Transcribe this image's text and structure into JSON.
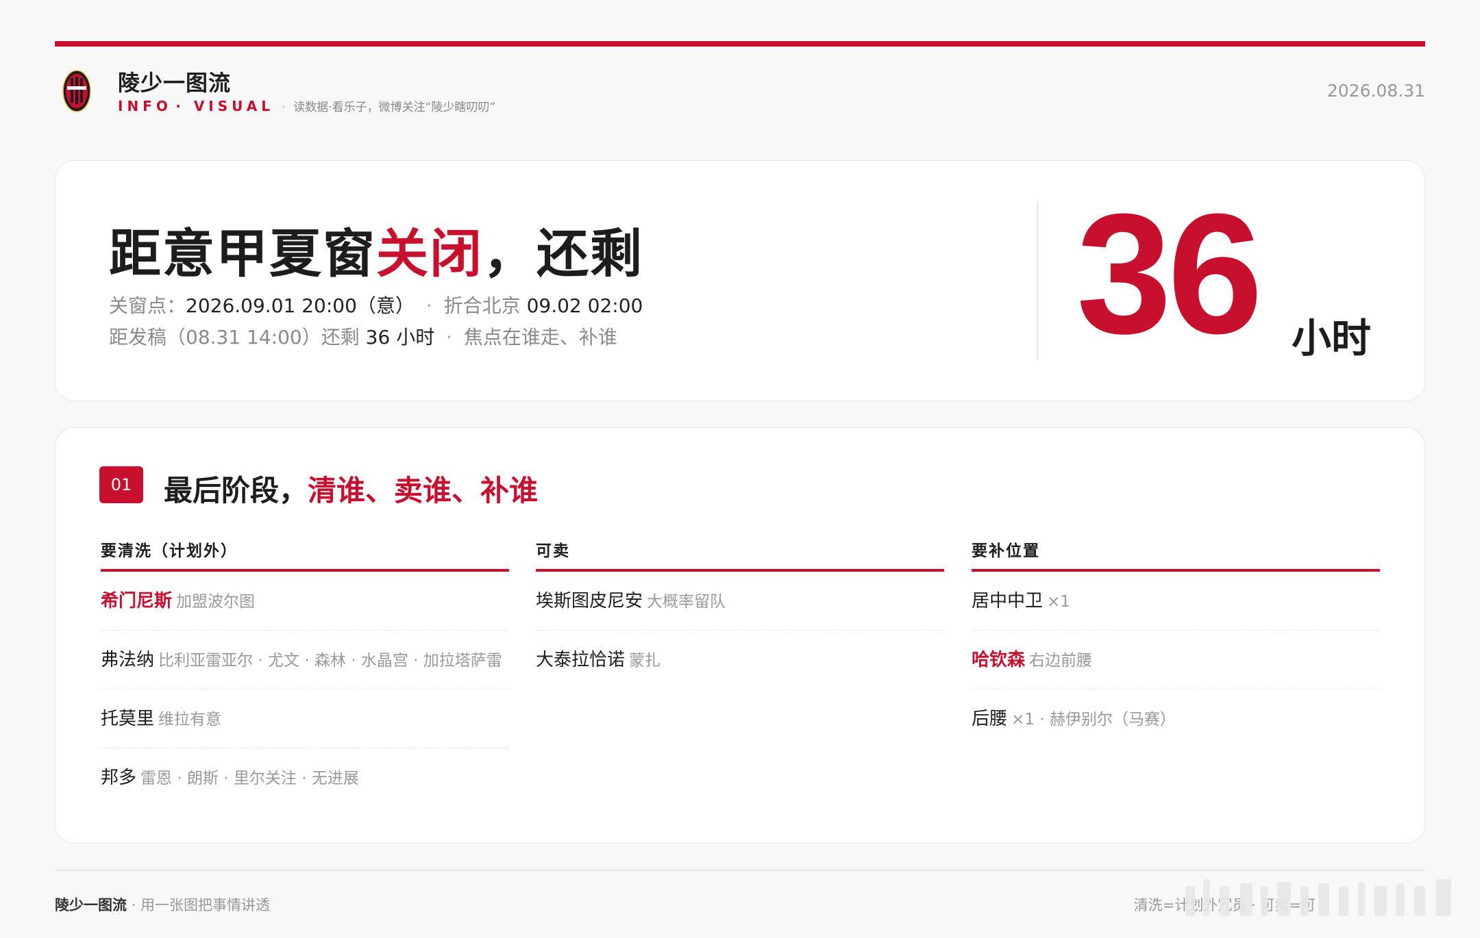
{
  "header": {
    "title": "陵少一图流",
    "sub_en_1": "INFO",
    "sub_en_2": "VISUAL",
    "sub_text": "读数据·看乐子，微博关注“陵少瞎叨叨”",
    "date": "2026.08.31"
  },
  "hero": {
    "title_pre": "距意甲夏窗",
    "title_red": "关闭",
    "title_post": "，还剩",
    "meta1_label": "关窗点：",
    "meta1_value": "2026.09.01 20:00（意）",
    "meta1_label2": "折合北京",
    "meta1_value2": "09.02 02:00",
    "meta2_pre": "距发稿（08.31 14:00）还剩",
    "meta2_value": "36 小时",
    "meta2_post": "焦点在谁走、补谁",
    "countdown": "36",
    "countdown_unit": "小时"
  },
  "section": {
    "badge": "01",
    "title_pre": "最后阶段，",
    "title_red": "清谁、卖谁、补谁",
    "columns": [
      {
        "header": "要清洗（计划外）",
        "rows": [
          {
            "name": "希门尼斯",
            "note": "加盟波尔图"
          },
          {
            "name": "弗法纳",
            "note": "比利亚雷亚尔 · 尤文 · 森林 · 水晶宫 · 加拉塔萨雷"
          },
          {
            "name": "托莫里",
            "note": "维拉有意"
          },
          {
            "name": "邦多",
            "note": "雷恩 · 朗斯 · 里尔关注 · 无进展"
          }
        ]
      },
      {
        "header": "可卖",
        "rows": [
          {
            "name": "埃斯图皮尼安",
            "note": "大概率留队"
          },
          {
            "name": "大泰拉恰诺",
            "note": "蒙扎"
          }
        ]
      },
      {
        "header": "要补位置",
        "rows": [
          {
            "name": "居中中卫",
            "note": "×1"
          },
          {
            "name": "哈钦森",
            "note": "右边前腰"
          },
          {
            "name": "后腰",
            "note": "×1 · 赫伊别尔（马赛）"
          }
        ]
      }
    ]
  },
  "footer": {
    "brand": "陵少一图流",
    "slogan": "用一张图把事情讲透",
    "legend": "清洗=计划外冗员 · 可卖=可"
  },
  "colors": {
    "accent": "#c8102e",
    "text": "#1d1d1f",
    "muted": "#999999",
    "background": "#f8f8f8"
  }
}
